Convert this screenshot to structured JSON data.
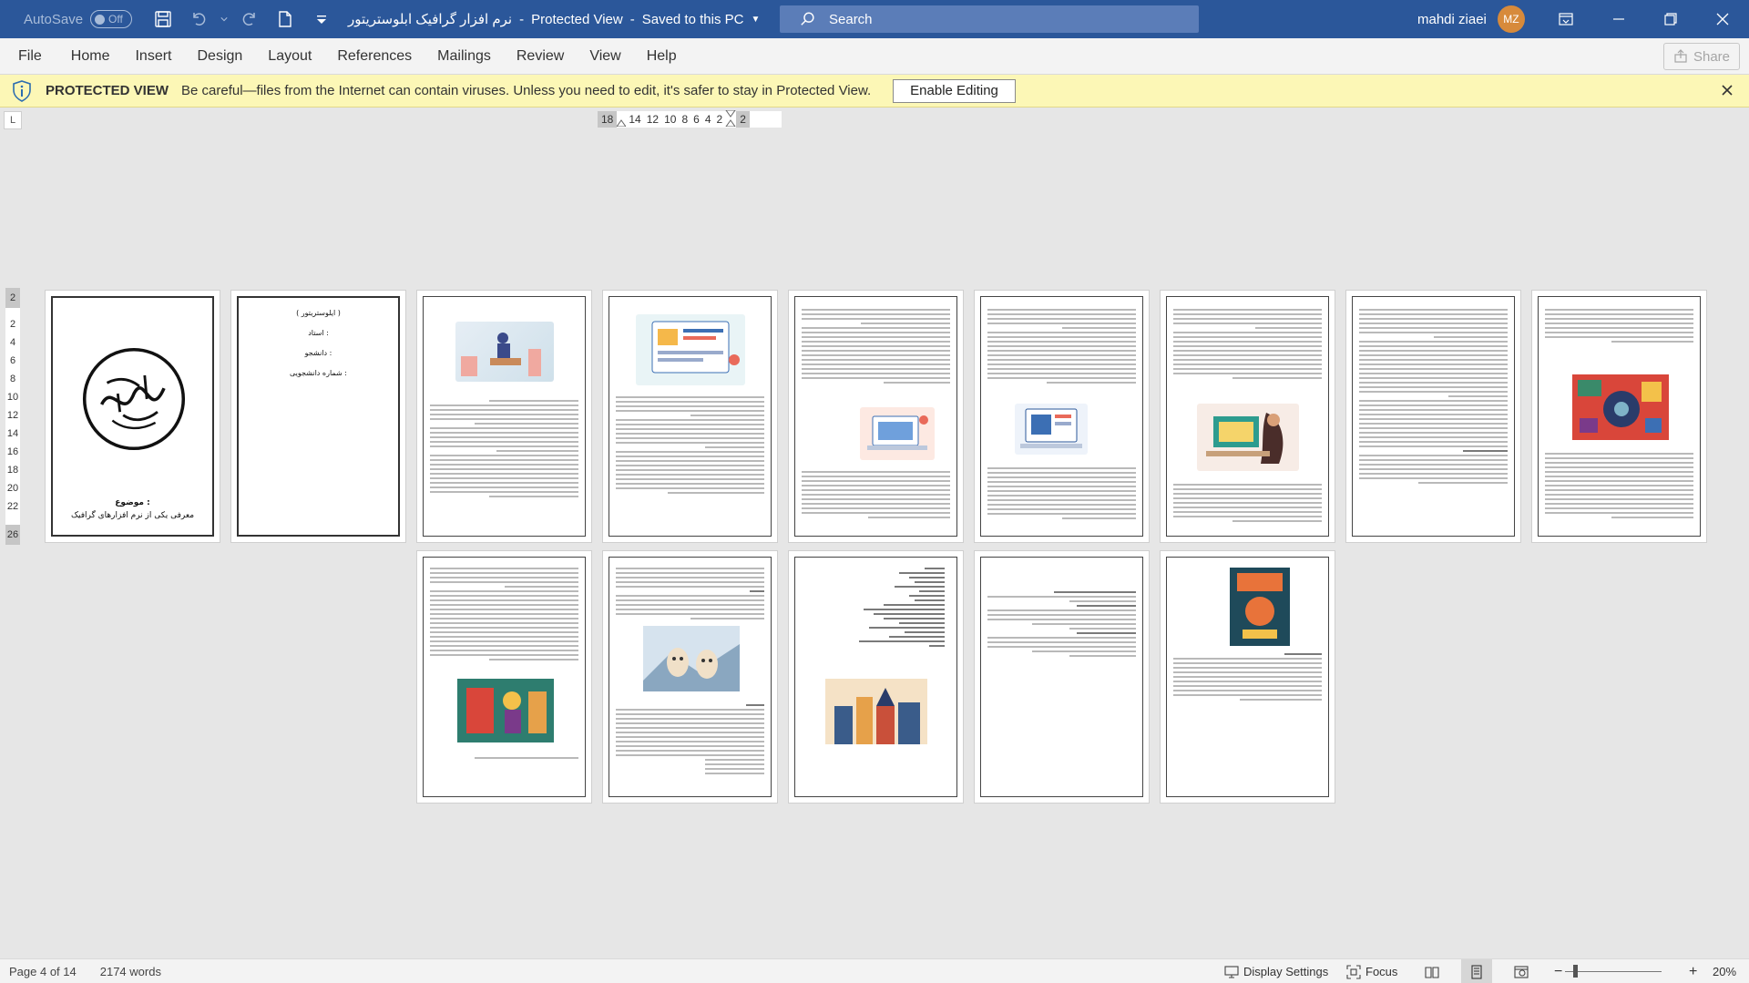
{
  "titlebar": {
    "autosave_label": "AutoSave",
    "autosave_state": "Off",
    "doc_name": "نرم افزار گرافیک ابلوستریتور",
    "protected_view": "Protected View",
    "save_status": "Saved to this PC",
    "separator": "-",
    "search_placeholder": "Search",
    "user_name": "mahdi ziaei",
    "user_initials": "MZ",
    "accent_color": "#2b579a"
  },
  "menu": {
    "items": [
      "File",
      "Home",
      "Insert",
      "Design",
      "Layout",
      "References",
      "Mailings",
      "Review",
      "View",
      "Help"
    ],
    "share_label": "Share"
  },
  "protected_bar": {
    "label": "PROTECTED VIEW",
    "message": "Be careful—files from the Internet can contain viruses. Unless you need to edit, it's safer to stay in Protected View.",
    "enable_label": "Enable Editing",
    "background": "#fcf7b6"
  },
  "ruler": {
    "corner": "L",
    "left_number": "18",
    "numbers": [
      "14",
      "12",
      "10",
      "8",
      "6",
      "4",
      "2"
    ],
    "right_number": "2",
    "vertical_top": "2",
    "vertical_numbers": [
      "2",
      "4",
      "6",
      "8",
      "10",
      "12",
      "14",
      "16",
      "18",
      "20",
      "22"
    ],
    "vertical_bottom": "26"
  },
  "cover": {
    "subject_label": "موضوع :",
    "subject_text": "معرفی یکی از نرم افزارهای گرافیک"
  },
  "page2": {
    "lines": [
      "( ایلوستریتور )",
      "استاد :",
      "دانشجو :",
      "شماره دانشجویی :"
    ]
  },
  "statusbar": {
    "page_info": "Page 4 of 14",
    "word_count": "2174 words",
    "display_settings": "Display Settings",
    "focus": "Focus",
    "zoom_minus": "−",
    "zoom_plus": "+",
    "zoom_level": "20%"
  }
}
